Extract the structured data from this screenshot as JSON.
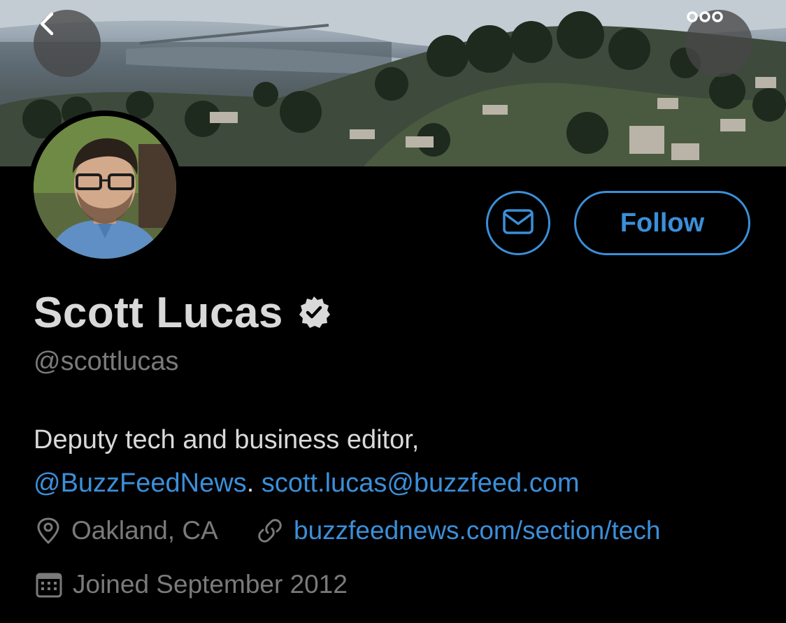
{
  "header": {
    "back_icon": "chevron-left-icon",
    "more_icon": "more-dots-icon"
  },
  "actions": {
    "message_icon": "envelope-icon",
    "follow_label": "Follow"
  },
  "profile": {
    "name": "Scott Lucas",
    "verified_icon": "verified-badge-icon",
    "handle": "@scottlucas",
    "bio_text_1": "Deputy tech and business editor,",
    "bio_mention": "@BuzzFeedNews",
    "bio_separator": ".",
    "bio_email": "scott.lucas@buzzfeed.com",
    "location": "Oakland, CA",
    "website": "buzzfeednews.com/section/tech",
    "joined": "Joined September 2012"
  },
  "colors": {
    "background": "#000000",
    "accent": "#3b8fd9",
    "text_primary": "#d9d9d9",
    "text_secondary": "#7a7a7a"
  }
}
